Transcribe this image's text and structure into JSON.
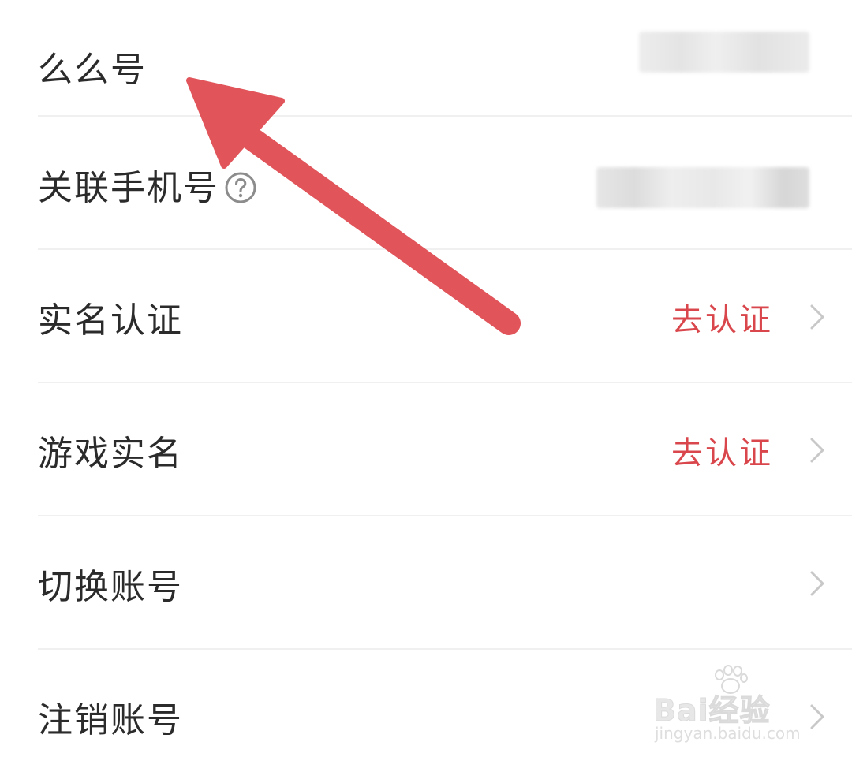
{
  "rows": [
    {
      "label": "么么号",
      "has_value_blurred": true
    },
    {
      "label": "关联手机号",
      "help_icon": "question-circle-icon",
      "has_value_blurred": true
    },
    {
      "label": "实名认证",
      "action": "去认证",
      "chevron": true
    },
    {
      "label": "游戏实名",
      "action": "去认证",
      "chevron": true
    },
    {
      "label": "切换账号",
      "chevron": true
    },
    {
      "label": "注销账号",
      "chevron": true
    }
  ],
  "annotation": {
    "icon": "red-arrow-icon",
    "color": "#e0545a"
  },
  "watermark": {
    "logo": "Bai经验",
    "url": "jingyan.baidu.com"
  },
  "colors": {
    "text": "#2b2b2b",
    "action": "#d9474c",
    "chevron": "#c8c8c8",
    "divider": "#f0f0f0",
    "background": "#ffffff"
  }
}
